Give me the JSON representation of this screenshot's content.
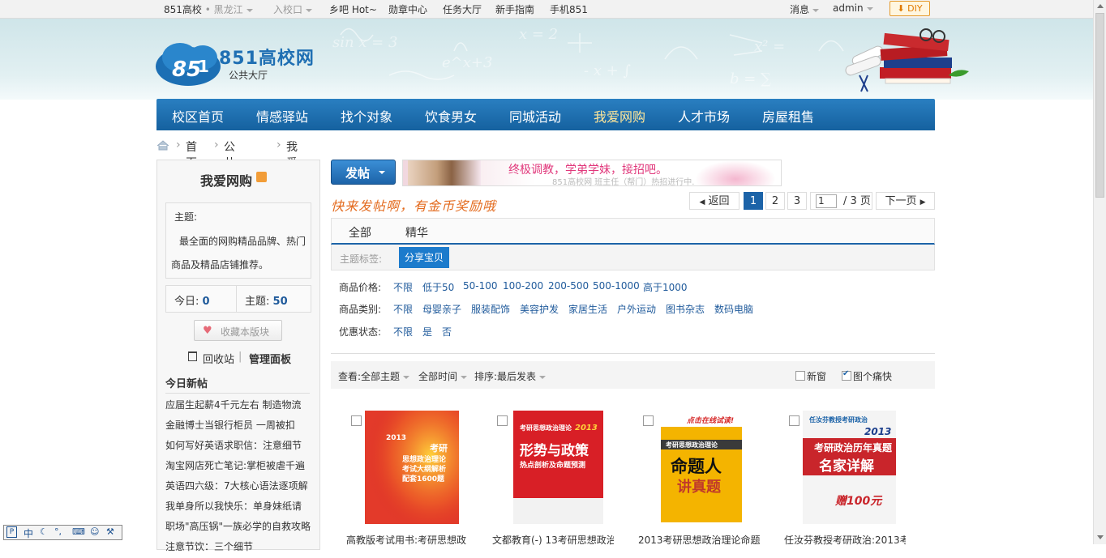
{
  "topbar": {
    "site": "851高校",
    "region": "黑龙江",
    "enter_school": "入校口",
    "links": [
      "乡吧 Hot~",
      "勋章中心",
      "任务大厅",
      "新手指南",
      "手机851"
    ],
    "messages": "消息",
    "user": "admin",
    "diy": "DIY"
  },
  "header": {
    "logo_text": "851高校网",
    "logo_sub": "公共大厅"
  },
  "nav": [
    "校区首页",
    "情感驿站",
    "找个对象",
    "饮食男女",
    "同城活动",
    "我爱网购",
    "人才市场",
    "房屋租售"
  ],
  "breadcrumb": [
    "首页",
    "公共大厅",
    "我爱网购"
  ],
  "sidebar": {
    "title": "我爱网购",
    "topic_label": "主题:",
    "topic_desc": "最全面的网购精品品牌、热门商品及精品店铺推荐。",
    "today_label": "今日:",
    "today_count": "0",
    "topics_label": "主题:",
    "topics_count": "50",
    "favorite": "收藏本版块",
    "recycle": "回收站",
    "manage": "管理面板",
    "new_posts_title": "今日新帖",
    "new_posts": [
      "应届生起薪4千元左右 制造物流",
      "金融博士当银行柜员 一周被扣",
      "如何写好英语求职信：注意细节",
      "淘宝网店死亡笔记:掌柜被虐千遍",
      "英语四六级：7大核心语法逐项解",
      "我单身所以我快乐：单身妹纸请",
      "职场\"高压锅\"一族必学的自救攻略",
      "注意节饮：三个细节"
    ]
  },
  "main": {
    "post_button": "发帖",
    "banner_text": "终极调教，学弟学妹，接招吧。",
    "banner_sub": "851高校网 班主任（帮门）热招进行中..",
    "slogan": "快来发帖啊，有金币奖励哦",
    "pagination": {
      "back": "返回",
      "pages": [
        "1",
        "2",
        "3"
      ],
      "current": "1",
      "total": "/ 3 页",
      "next": "下一页"
    },
    "tabs": [
      "全部",
      "精华"
    ],
    "tag_label": "主题标签:",
    "tag": "分享宝贝",
    "filters": [
      {
        "key": "商品价格:",
        "values": [
          "不限",
          "低于50",
          "50-100",
          "100-200",
          "200-500",
          "500-1000",
          "高于1000"
        ]
      },
      {
        "key": "商品类别:",
        "values": [
          "不限",
          "母婴亲子",
          "服装配饰",
          "美容护发",
          "家居生活",
          "户外运动",
          "图书杂志",
          "数码电脑"
        ]
      },
      {
        "key": "优惠状态:",
        "values": [
          "不限",
          "是",
          "否"
        ]
      }
    ],
    "viewbar": {
      "view_label": "查看:",
      "view_all": "全部主题",
      "time_all": "全部时间",
      "sort_label": "排序:",
      "sort_value": "最后发表",
      "new_window": "新窗",
      "image_mode": "图个痛快"
    },
    "products": [
      {
        "title": "高教版考试用书:考研思想政",
        "cover_lines": [
          "2013",
          "考研",
          "思想政治理论",
          "考试大纲解析",
          "配套1600题"
        ]
      },
      {
        "title": "文都教育(-) 13考研思想政治",
        "cover_lines": [
          "考研思想政治理论",
          "形势与政策",
          "热点剖析及命题预测",
          "2013"
        ]
      },
      {
        "title": "2013考研思想政治理论命题人",
        "cover_lines": [
          "点击在线试读!",
          "考研思想政治理论",
          "命题人",
          "讲真题"
        ]
      },
      {
        "title": "任汝芬教授考研政治:2013考",
        "cover_lines": [
          "任汝芬教授考研政治",
          "2013",
          "考研政治历年真题",
          "名家详解",
          "赠100元"
        ]
      }
    ]
  },
  "ime": {
    "label": "中"
  }
}
